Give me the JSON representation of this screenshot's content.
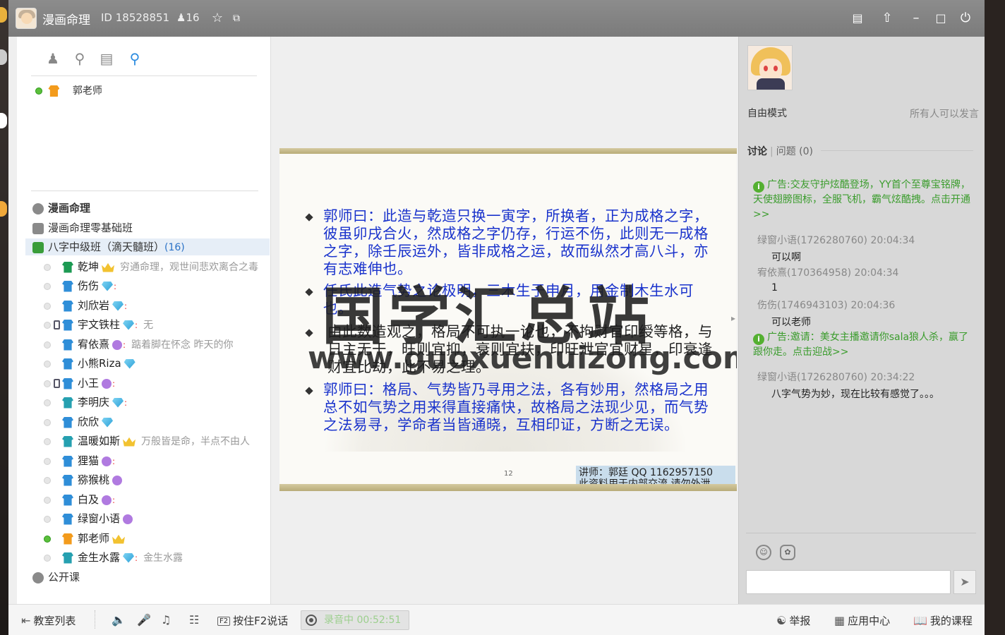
{
  "window": {
    "room_name": "漫画命理",
    "room_id": "ID 18528851",
    "user_count": "16"
  },
  "left_panel": {
    "teacher_name": "郭老师",
    "channels": [
      {
        "label": "漫画命理",
        "bold": true
      },
      {
        "label": "漫画命理零基础班"
      },
      {
        "label": "八字中级班（滴天髓班）",
        "count": "(16)",
        "selected": true
      },
      {
        "label": "公开课"
      }
    ],
    "members": [
      {
        "name": "乾坤",
        "badge": "crown",
        "signature": "穷通命理，观世间悲欢离合之毒"
      },
      {
        "name": "伤伤",
        "badge": "diamond",
        "mark": ":"
      },
      {
        "name": "刘欣岩",
        "badge": "diamond",
        "mark": ":"
      },
      {
        "name": "宇文铁柱",
        "badge": "diamond",
        "mark": ":",
        "signature": "无"
      },
      {
        "name": "宥依熹",
        "badge": "purple",
        "mark": ":",
        "signature": "踮着脚在怀念 昨天的你"
      },
      {
        "name": "小熊Riza",
        "badge": "diamond"
      },
      {
        "name": "小王",
        "badge": "purple",
        "mark": ":"
      },
      {
        "name": "李明庆",
        "badge": "diamond",
        "mark": ":"
      },
      {
        "name": "欣欣",
        "badge": "diamond"
      },
      {
        "name": "温暖如斯",
        "badge": "crown",
        "signature": "万般皆是命，半点不由人"
      },
      {
        "name": "狸猫",
        "badge": "purple",
        "mark": ":"
      },
      {
        "name": "猕猴桃",
        "badge": "purple"
      },
      {
        "name": "白及",
        "badge": "purple",
        "mark": ":"
      },
      {
        "name": "绿窗小语",
        "badge": "purple"
      },
      {
        "name": "郭老师",
        "badge": "crown",
        "online": true
      },
      {
        "name": "金生水露",
        "badge": "diamond",
        "mark": ":",
        "signature": "金生水露"
      }
    ]
  },
  "slide": {
    "p1": "郭师曰：此造与乾造只换一寅字，所换者，正为成格之字，彼虽卯戌合火，然成格之字仍存，行运不伤，此则无一成格之字，除壬辰运外，皆非成格之运，故而纵然才高八斗，亦有志难伸也。",
    "p2": "任氏此造气势之论极明，三木生于申月，用金制木生水可也。",
    "p3": "由此数造观之，格局不可执一论也，不拘财官印绶等格，与日主无干，旺则宜抑，衰则宜扶，印旺泄官宜财星，印衰逢财宜比劫，此不易之理。",
    "p4": "郭师曰：格局、气势皆乃寻用之法，各有妙用，然格局之用总不如气势之用来得直接痛快，故格局之法现少见，而气势之法易寻，学命者当皆通晓，互相印证，方断之无误。",
    "page_num": "12",
    "footer_line1": "讲师：郭廷 QQ 1162957150",
    "footer_line2": "此资料用于内部交流 请勿外泄",
    "watermark_cn": "国学汇总站",
    "watermark_url": "www.guoxuehuizong.com"
  },
  "right_panel": {
    "mode_label": "自由模式",
    "mode_desc": "所有人可以发言",
    "tab_discuss": "讨论",
    "tab_question": "问题",
    "question_count": "(0)",
    "chat": [
      {
        "type": "ad",
        "text": "广告:交友守护炫酷登场，YY首个至尊宝铭牌，天使翅膀图标，全服飞机，霸气炫酷拽。点击开通>>"
      },
      {
        "type": "msg",
        "head": "绿窗小语(1726280760) 20:04:34",
        "body": "可以啊"
      },
      {
        "type": "msg",
        "head": "宥依熹(170364958) 20:04:34",
        "body": "1"
      },
      {
        "type": "msg",
        "head": "伤伤(1746943103) 20:04:36",
        "body": "可以老师"
      },
      {
        "type": "ad",
        "text": "广告:邀请：美女主播邀请你sala狼人杀，赢了跟你走。点击迎战>>"
      },
      {
        "type": "msg",
        "head": "绿窗小语(1726280760) 20:34:22",
        "body": "八字气势为妙，现在比较有感觉了。。。"
      }
    ],
    "input_value": ""
  },
  "bottom_bar": {
    "classroom_list": "教室列表",
    "f2_key": "F2",
    "f2_label": "按住F2说话",
    "recording": "录音中 00:52:51",
    "report": "举报",
    "app_center": "应用中心",
    "my_courses": "我的课程"
  },
  "icons": {
    "title": [
      "user-icon",
      "star-icon",
      "external-link-icon",
      "notes-icon",
      "skin-icon",
      "minimize-icon",
      "maximize-icon",
      "power-icon"
    ],
    "left_tabs": [
      "members-icon",
      "location-icon",
      "notes-icon",
      "search-icon"
    ]
  }
}
